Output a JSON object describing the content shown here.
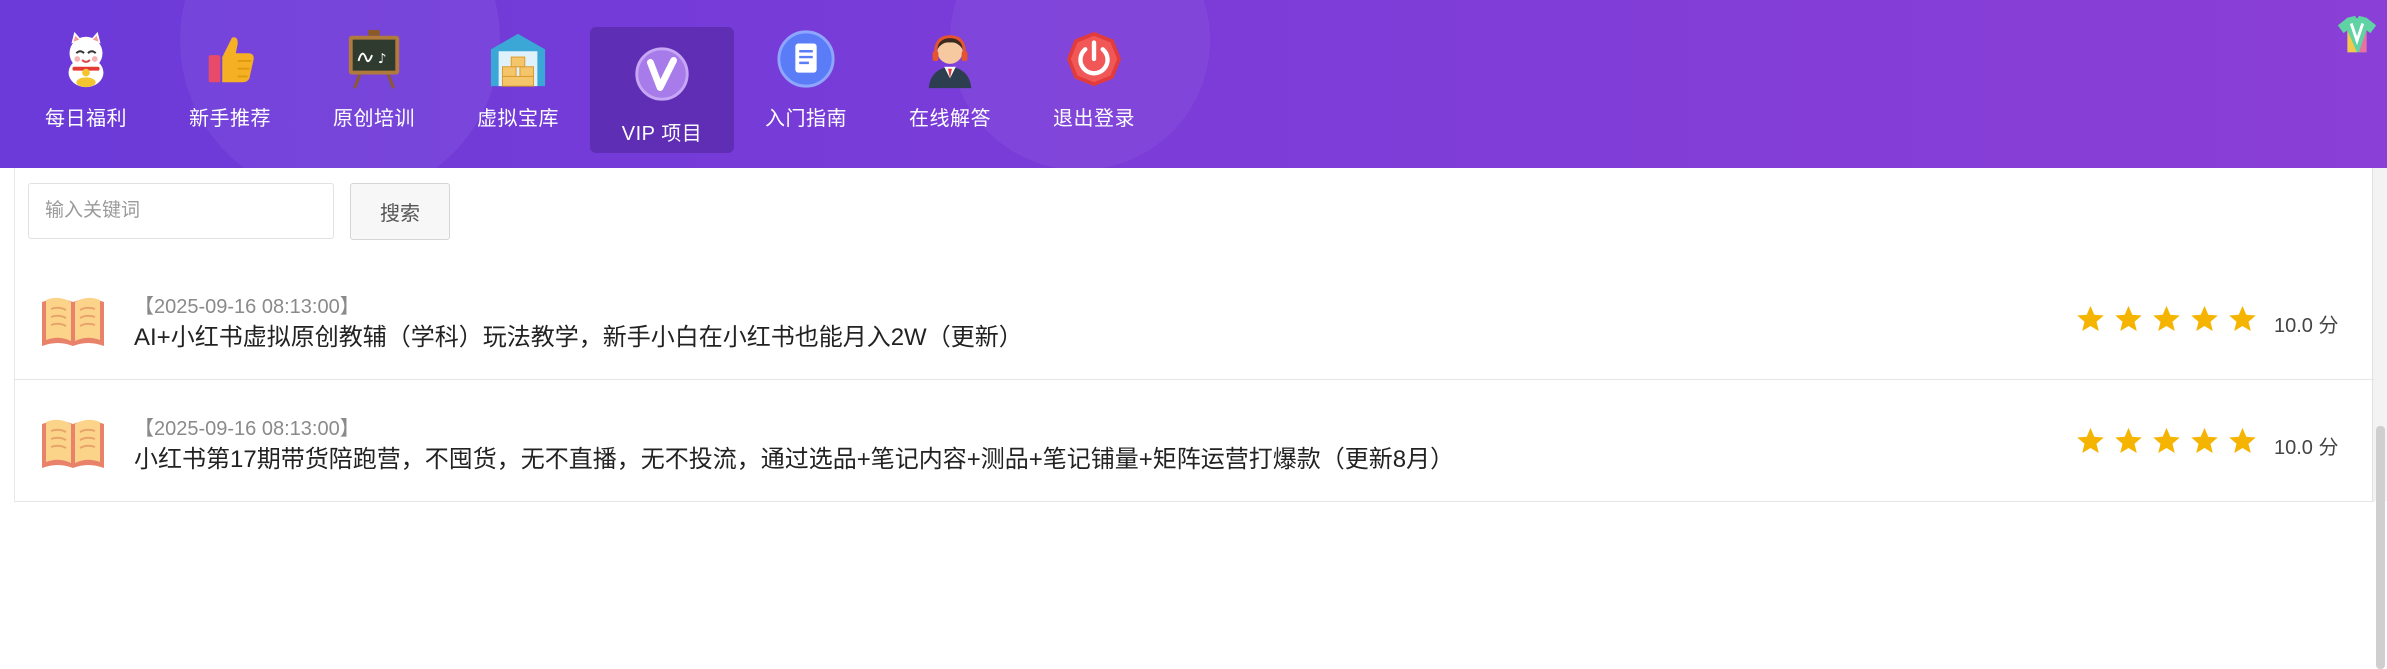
{
  "colors": {
    "header_start": "#6b3ad8",
    "header_end": "#8a3fd6",
    "star": "#f5b400",
    "book": "#f08a6a"
  },
  "nav": {
    "items": [
      {
        "label": "每日福利",
        "icon": "lucky-cat-icon"
      },
      {
        "label": "新手推荐",
        "icon": "thumbs-up-icon"
      },
      {
        "label": "原创培训",
        "icon": "chalkboard-icon"
      },
      {
        "label": "虚拟宝库",
        "icon": "warehouse-icon"
      },
      {
        "label": "VIP 项目",
        "icon": "vip-badge-icon",
        "active": true
      },
      {
        "label": "入门指南",
        "icon": "guide-document-icon"
      },
      {
        "label": "在线解答",
        "icon": "customer-service-icon"
      },
      {
        "label": "退出登录",
        "icon": "power-icon"
      }
    ]
  },
  "search": {
    "placeholder": "输入关键词",
    "value": "",
    "button_label": "搜索"
  },
  "posts": [
    {
      "date": "【2025-09-16 08:13:00】",
      "title": "AI+小红书虚拟原创教辅（学科）玩法教学，新手小白在小红书也能月入2W（更新）",
      "rating": 5,
      "score": "10.0 分"
    },
    {
      "date": "【2025-09-16 08:13:00】",
      "title": "小红书第17期带货陪跑营，不囤货，无不直播，无不投流，通过选品+笔记内容+测品+笔记铺量+矩阵运营打爆款（更新8月）",
      "rating": 5,
      "score": "10.0 分"
    }
  ]
}
